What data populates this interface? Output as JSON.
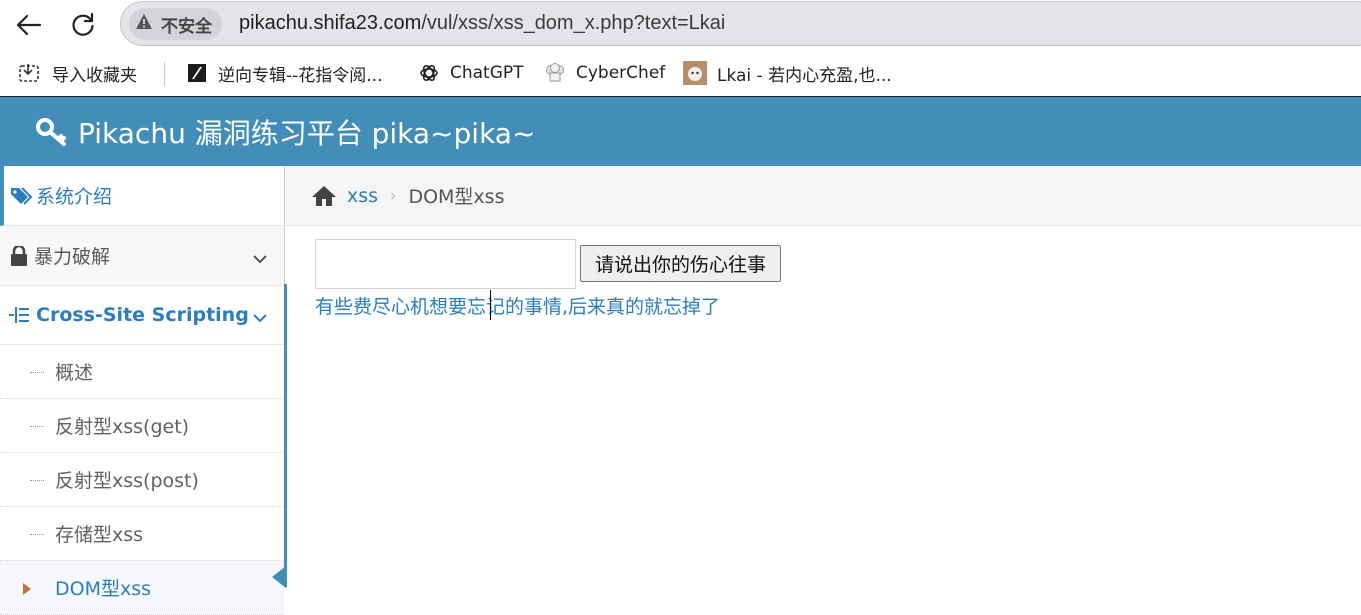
{
  "browser": {
    "security_label": "不安全",
    "url_host": "pikachu.shifa23.com",
    "url_path": "/vul/xss/xss_dom_x.php?text=Lkai",
    "bookmarks": [
      {
        "label": "导入收藏夹",
        "icon": "import-bookmarks-icon"
      },
      {
        "label": "逆向专辑--花指令阅...",
        "icon": "site-logo-icon"
      },
      {
        "label": "ChatGPT",
        "icon": "chatgpt-icon"
      },
      {
        "label": "CyberChef",
        "icon": "chef-hat-icon"
      },
      {
        "label": "Lkai - 若内心充盈,也...",
        "icon": "avatar-icon"
      }
    ]
  },
  "header": {
    "title": "Pikachu 漏洞练习平台 pika~pika~",
    "icon": "key-icon",
    "bg_color": "#438eb9"
  },
  "sidebar": {
    "items": [
      {
        "label": "系统介绍",
        "icon": "tags-icon"
      },
      {
        "label": "暴力破解",
        "icon": "lock-icon"
      },
      {
        "label": "Cross-Site Scripting",
        "icon": "list-icon"
      }
    ],
    "subitems": [
      {
        "label": "概述"
      },
      {
        "label": "反射型xss(get)"
      },
      {
        "label": "反射型xss(post)"
      },
      {
        "label": "存储型xss"
      },
      {
        "label": "DOM型xss"
      }
    ]
  },
  "breadcrumb": {
    "icon": "home-icon",
    "section": "xss",
    "current": "DOM型xss"
  },
  "main": {
    "input_value": "",
    "button_label": "请说出你的伤心往事",
    "link_text": "有些费尽心机想要忘记的事情,后来真的就忘掉了"
  },
  "colors": {
    "accent": "#2b7dbc",
    "header": "#438eb9"
  }
}
